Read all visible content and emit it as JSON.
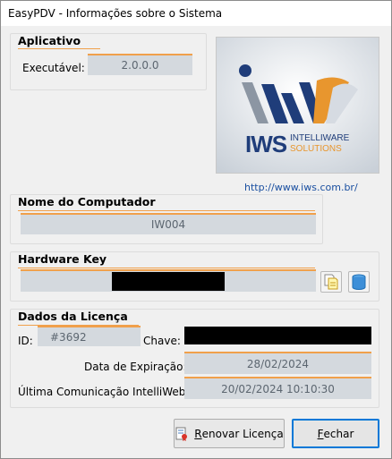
{
  "window": {
    "title": "EasyPDV - Informações sobre o Sistema"
  },
  "aplicativo": {
    "title": "Aplicativo",
    "executavel_label": "Executável:",
    "executavel_value": "2.0.0.0"
  },
  "logo": {
    "brand": "IWS",
    "line1": "INTELLIWARE",
    "line2": "SOLUTIONS",
    "link": "http://www.iws.com.br/"
  },
  "computador": {
    "title": "Nome do Computador",
    "value": "IW004"
  },
  "hardware": {
    "title": "Hardware Key"
  },
  "licenca": {
    "title": "Dados da Licença",
    "id_label": "ID:",
    "id_value": "#3692",
    "chave_label": "Chave:",
    "expiracao_label": "Data de Expiração:",
    "expiracao_value": "28/02/2024",
    "comunicacao_label": "Última Comunicação IntelliWeb:",
    "comunicacao_value": "20/02/2024 10:10:30"
  },
  "buttons": {
    "renovar_first": "R",
    "renovar_rest": "enovar Licença",
    "fechar_first": "F",
    "fechar_rest": "echar"
  },
  "colors": {
    "accent": "#f0a04b",
    "field_bg": "#d4d9de",
    "logo_blue": "#1f3d7a",
    "logo_orange": "#e8962e"
  }
}
